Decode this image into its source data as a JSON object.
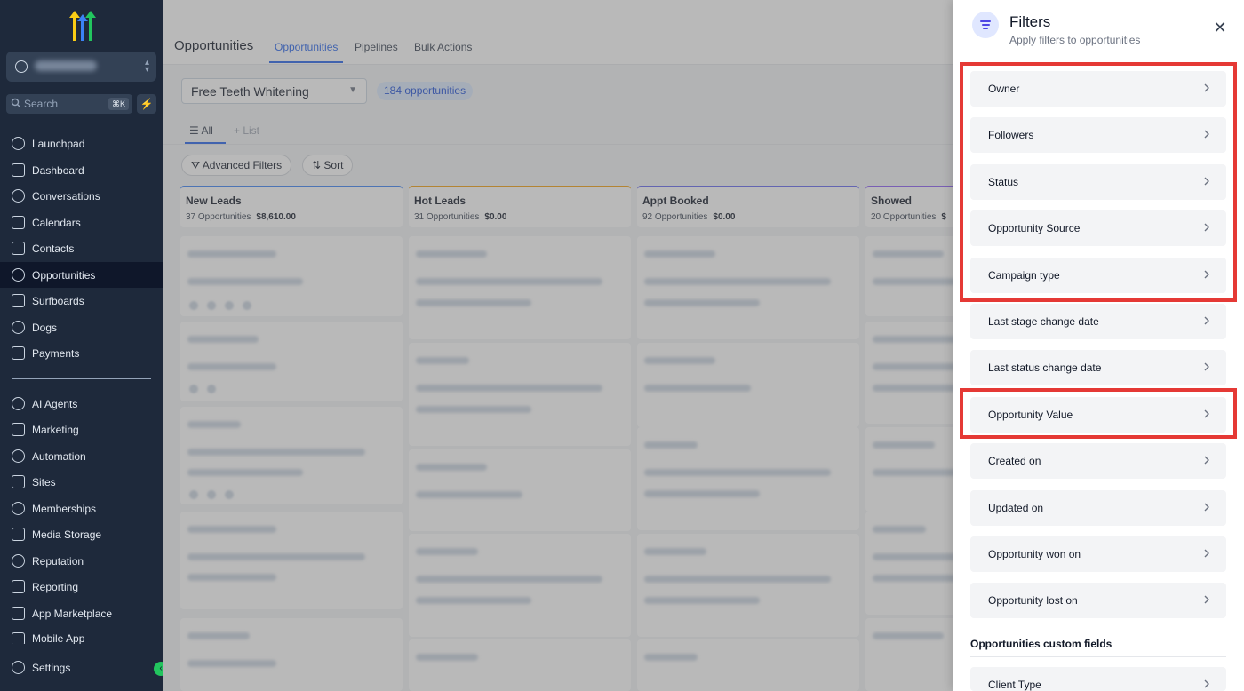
{
  "sidebar": {
    "search_placeholder": "Search",
    "search_shortcut": "⌘K",
    "items": [
      {
        "label": "Launchpad"
      },
      {
        "label": "Dashboard"
      },
      {
        "label": "Conversations"
      },
      {
        "label": "Calendars"
      },
      {
        "label": "Contacts"
      },
      {
        "label": "Opportunities"
      },
      {
        "label": "Surfboards"
      },
      {
        "label": "Dogs"
      },
      {
        "label": "Payments"
      },
      {
        "label": "AI Agents"
      },
      {
        "label": "Marketing"
      },
      {
        "label": "Automation"
      },
      {
        "label": "Sites"
      },
      {
        "label": "Memberships"
      },
      {
        "label": "Media Storage"
      },
      {
        "label": "Reputation"
      },
      {
        "label": "Reporting"
      },
      {
        "label": "App Marketplace"
      },
      {
        "label": "Mobile App"
      }
    ],
    "settings_label": "Settings",
    "active_item": "Opportunities"
  },
  "header": {
    "title": "Opportunities",
    "tabs": [
      {
        "label": "Opportunities"
      },
      {
        "label": "Pipelines"
      },
      {
        "label": "Bulk Actions"
      }
    ]
  },
  "toolbar": {
    "pipeline": "Free Teeth Whitening",
    "count": "184 opportunities",
    "view_all": "All",
    "view_list": "List",
    "advanced_filters": "Advanced Filters",
    "sort": "Sort"
  },
  "columns": [
    {
      "name": "New Leads",
      "count": "37 Opportunities",
      "value": "$8,610.00"
    },
    {
      "name": "Hot Leads",
      "count": "31 Opportunities",
      "value": "$0.00"
    },
    {
      "name": "Appt Booked",
      "count": "92 Opportunities",
      "value": "$0.00"
    },
    {
      "name": "Showed",
      "count": "20 Opportunities",
      "value": "$"
    }
  ],
  "filters_panel": {
    "title": "Filters",
    "subtitle": "Apply filters to opportunities",
    "items": [
      {
        "label": "Owner"
      },
      {
        "label": "Followers"
      },
      {
        "label": "Status"
      },
      {
        "label": "Opportunity Source"
      },
      {
        "label": "Campaign type"
      },
      {
        "label": "Last stage change date"
      },
      {
        "label": "Last status change date"
      },
      {
        "label": "Opportunity Value"
      },
      {
        "label": "Created on"
      },
      {
        "label": "Updated on"
      },
      {
        "label": "Opportunity won on"
      },
      {
        "label": "Opportunity lost on"
      }
    ],
    "custom_section": "Opportunities custom fields",
    "custom_items": [
      {
        "label": "Client Type"
      }
    ]
  },
  "colors": {
    "sidebar_bg": "#1e293b",
    "accent": "#2563eb",
    "highlight": "#e53935"
  }
}
